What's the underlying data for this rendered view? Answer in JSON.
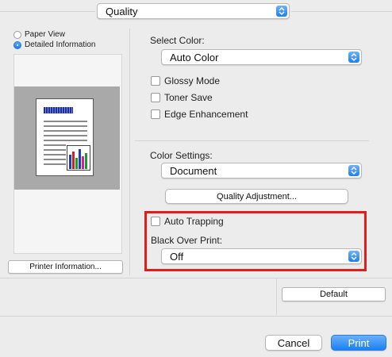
{
  "panel_menu": {
    "value": "Quality"
  },
  "preview": {
    "options": [
      {
        "label": "Paper View",
        "selected": false
      },
      {
        "label": "Detailed Information",
        "selected": true
      }
    ],
    "printer_info_button": "Printer Information..."
  },
  "select_color": {
    "label": "Select Color:",
    "value": "Auto Color"
  },
  "checkboxes": [
    {
      "label": "Glossy Mode",
      "checked": false
    },
    {
      "label": "Toner Save",
      "checked": false
    },
    {
      "label": "Edge Enhancement",
      "checked": false
    }
  ],
  "color_settings": {
    "label": "Color Settings:",
    "value": "Document"
  },
  "quality_adjustment_button": "Quality Adjustment...",
  "auto_trapping": {
    "label": "Auto Trapping",
    "checked": false
  },
  "black_over_print": {
    "label": "Black Over Print:",
    "value": "Off"
  },
  "default_button": "Default",
  "footer": {
    "cancel": "Cancel",
    "print": "Print"
  },
  "colors": {
    "accent": "#1b7ff3",
    "highlight": "#e51c1c"
  }
}
